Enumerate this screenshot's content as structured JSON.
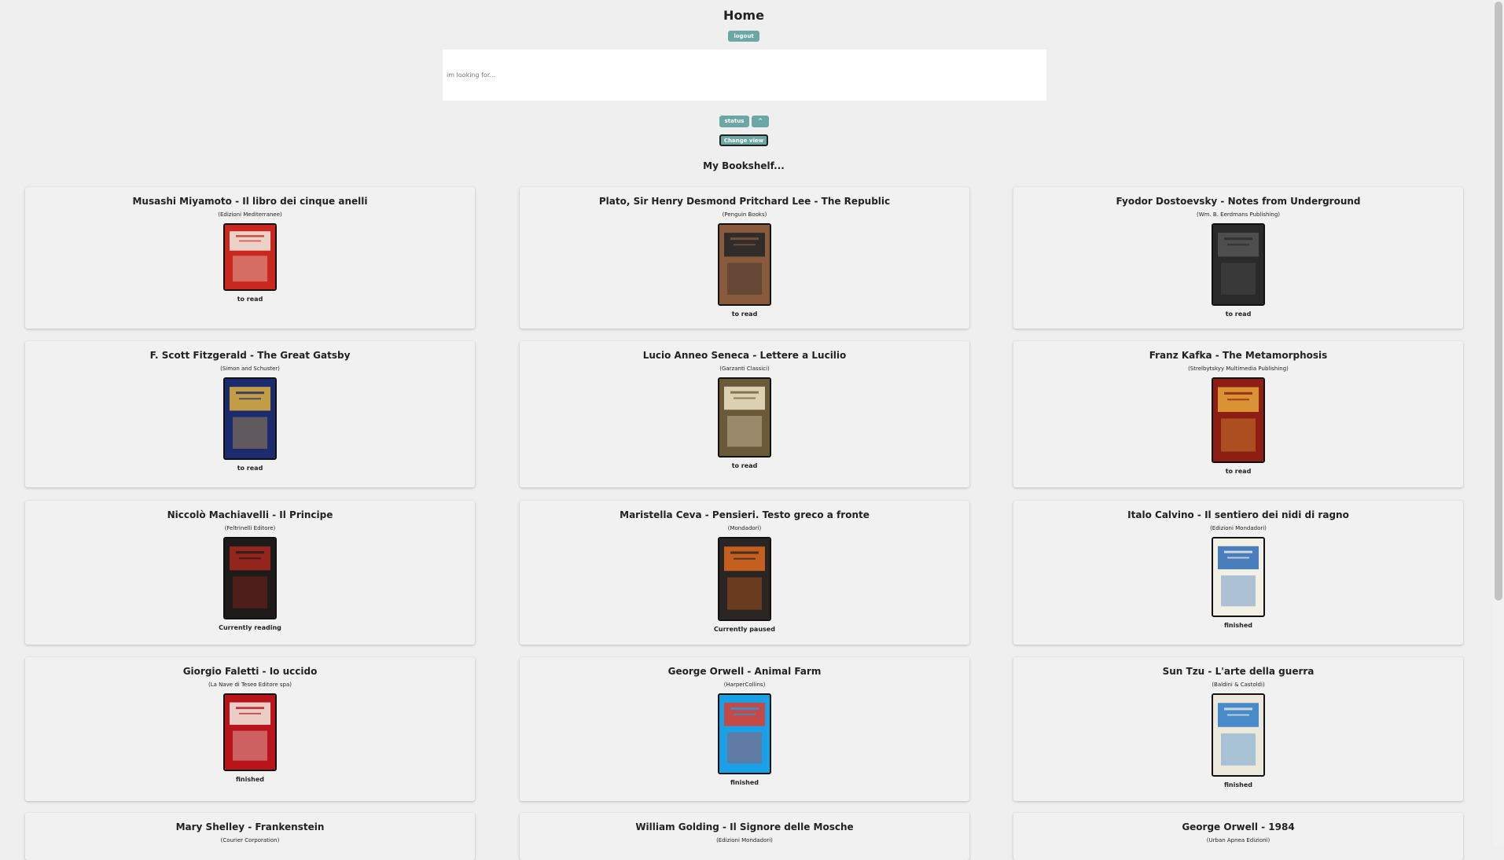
{
  "header": {
    "title": "Home",
    "logout_label": "logout"
  },
  "search": {
    "placeholder": "im looking for..."
  },
  "controls": {
    "status_label": "status",
    "sort_label": "^",
    "change_view_label": "Change view"
  },
  "shelf_title": "My Bookshelf...",
  "books": [
    {
      "title": "Musashi Miyamoto - Il libro dei cinque anelli",
      "publisher": "(Edizioni Mediterranee)",
      "status": "to read",
      "cover_icon": "book-cover-cinque-anelli",
      "cover_colors": [
        "#c8281e",
        "#f2efe6"
      ]
    },
    {
      "title": "Plato, Sir Henry Desmond Pritchard Lee - The Republic",
      "publisher": "(Penguin Books)",
      "status": "to read",
      "cover_icon": "book-cover-republic",
      "cover_colors": [
        "#8a5a3c",
        "#1e2428"
      ]
    },
    {
      "title": "Fyodor Dostoevsky - Notes from Underground",
      "publisher": "(Wm. B. Eerdmans Publishing)",
      "status": "to read",
      "cover_icon": "book-cover-notes-underground",
      "cover_colors": [
        "#2a2a2a",
        "#555555"
      ]
    },
    {
      "title": "F. Scott Fitzgerald - The Great Gatsby",
      "publisher": "(Simon and Schuster)",
      "status": "to read",
      "cover_icon": "book-cover-great-gatsby",
      "cover_colors": [
        "#1c2a6e",
        "#e0b240"
      ]
    },
    {
      "title": "Lucio Anneo Seneca - Lettere a Lucilio",
      "publisher": "(Garzanti Classici)",
      "status": "to read",
      "cover_icon": "book-cover-lettere-lucilio",
      "cover_colors": [
        "#6b5a3a",
        "#efe6c8"
      ]
    },
    {
      "title": "Franz Kafka - The Metamorphosis",
      "publisher": "(Strelbytskyy Multimedia Publishing)",
      "status": "to read",
      "cover_icon": "book-cover-metamorphosis",
      "cover_colors": [
        "#8e1e14",
        "#e8a83a"
      ]
    },
    {
      "title": "Niccolò Machiavelli - Il Principe",
      "publisher": "(Feltrinelli Editore)",
      "status": "Currently reading",
      "cover_icon": "book-cover-il-principe",
      "cover_colors": [
        "#1e1a1a",
        "#a8281e"
      ]
    },
    {
      "title": "Maristella Ceva - Pensieri. Testo greco a fronte",
      "publisher": "(Mondadori)",
      "status": "Currently paused",
      "cover_icon": "book-cover-pensieri",
      "cover_colors": [
        "#2a2422",
        "#e06a1e"
      ]
    },
    {
      "title": "Italo Calvino - Il sentiero dei nidi di ragno",
      "publisher": "(Edizioni Mondadori)",
      "status": "finished",
      "cover_icon": "book-cover-sentiero-nidi",
      "cover_colors": [
        "#f3f0e6",
        "#2a6ab4"
      ]
    },
    {
      "title": "Giorgio Faletti - Io uccido",
      "publisher": "(La Nave di Teseo Editore spa)",
      "status": "finished",
      "cover_icon": "book-cover-io-uccido",
      "cover_colors": [
        "#b8141a",
        "#f4efe8"
      ]
    },
    {
      "title": "George Orwell - Animal Farm",
      "publisher": "(HarperCollins)",
      "status": "finished",
      "cover_icon": "book-cover-animal-farm",
      "cover_colors": [
        "#1aa0e6",
        "#e43a2a"
      ]
    },
    {
      "title": "Sun Tzu - L'arte della guerra",
      "publisher": "(Baldini & Castoldi)",
      "status": "finished",
      "cover_icon": "book-cover-arte-guerra",
      "cover_colors": [
        "#ece8dc",
        "#2a7ac8"
      ]
    },
    {
      "title": "Mary Shelley - Frankenstein",
      "publisher": "(Courier Corporation)",
      "status": "",
      "cover_icon": "",
      "cover_colors": []
    },
    {
      "title": "William Golding - Il Signore delle Mosche",
      "publisher": "(Edizioni Mondadori)",
      "status": "",
      "cover_icon": "",
      "cover_colors": []
    },
    {
      "title": "George Orwell - 1984",
      "publisher": "(Urban Apnea Edizioni)",
      "status": "",
      "cover_icon": "",
      "cover_colors": []
    }
  ]
}
